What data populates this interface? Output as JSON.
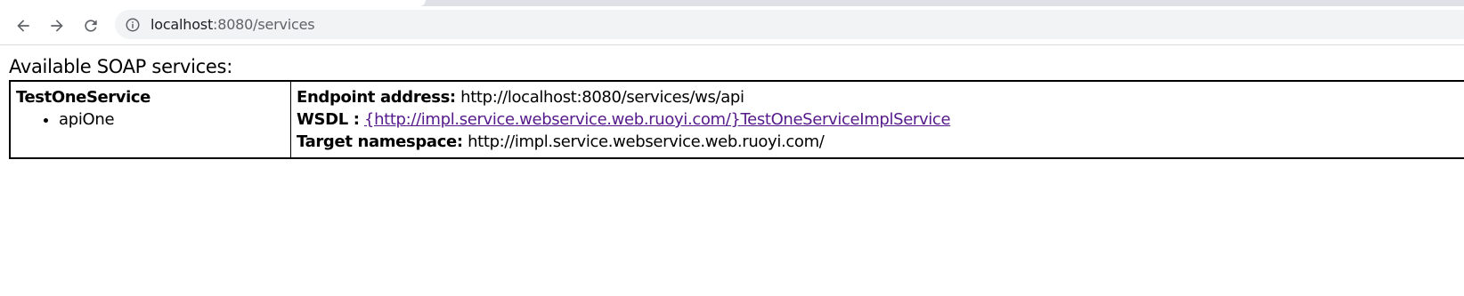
{
  "browser": {
    "url_host": "localhost",
    "url_path": ":8080/services",
    "icons": {
      "back": "arrow-left-icon",
      "forward": "arrow-right-icon",
      "reload": "reload-icon",
      "site_info": "info-icon"
    }
  },
  "page": {
    "heading": "Available SOAP services:",
    "services": [
      {
        "name": "TestOneService",
        "operations": [
          "apiOne"
        ],
        "endpoint_label": "Endpoint address:",
        "endpoint_value": "http://localhost:8080/services/ws/api",
        "wsdl_label": "WSDL :",
        "wsdl_link_text": "{http://impl.service.webservice.web.ruoyi.com/}TestOneServiceImplService",
        "namespace_label": "Target namespace:",
        "namespace_value": "http://impl.service.webservice.web.ruoyi.com/"
      }
    ]
  },
  "colors": {
    "link_visited": "#551a8b",
    "omnibox_bg": "#f1f3f4",
    "tabstrip_bg": "#dee1e6"
  }
}
